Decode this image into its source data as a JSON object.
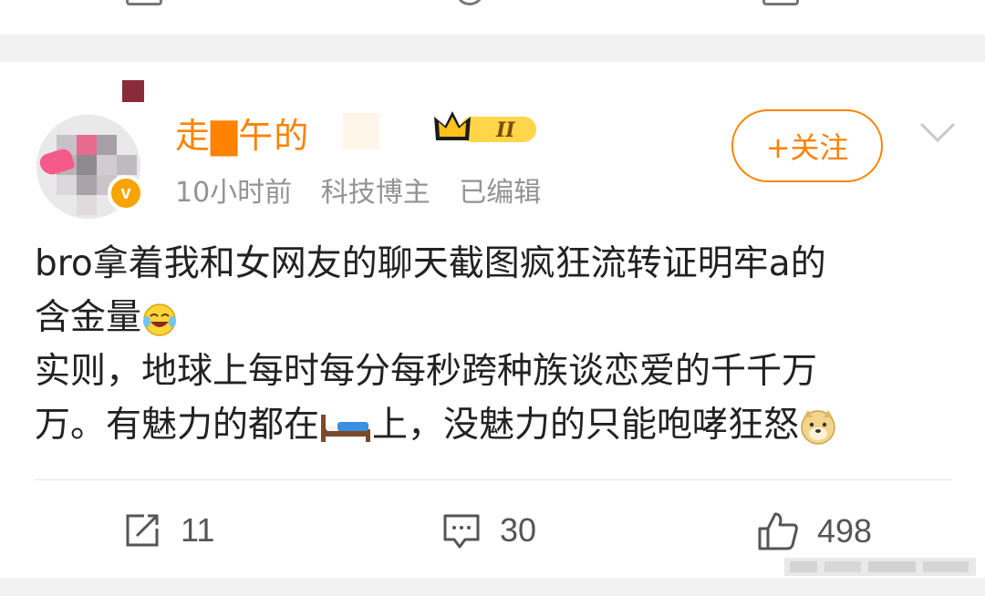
{
  "post": {
    "username": "走▇午的",
    "meta": {
      "time": "10小时前",
      "tag": "科技博主",
      "edited": "已编辑"
    },
    "follow_label": "+关注",
    "text_line1": "bro拿着我和女网友的聊天截图疯狂流转证明牢a的",
    "text_line2": "含金量",
    "text_line3": "实则，地球上每时每分每秒跨种族谈恋爱的千千万",
    "text_line4a": "万。有魅力的都在",
    "text_line4b": "上，没魅力的只能咆哮狂怒"
  },
  "actions": {
    "repost_count": "11",
    "comment_count": "30",
    "like_count": "498"
  },
  "icons": {
    "verified": "v-verified-icon",
    "crown": "crown-badge-icon",
    "chevron": "chevron-down-icon",
    "repost": "share-icon",
    "comment": "comment-icon",
    "like": "thumbs-up-icon",
    "laugh_cry": "laughing-crying-emoji",
    "bed": "bed-emoji",
    "doge": "doge-emoji"
  },
  "colors": {
    "accent": "#ff8200",
    "meta": "#939393",
    "text": "#222222",
    "icon": "#555555"
  }
}
